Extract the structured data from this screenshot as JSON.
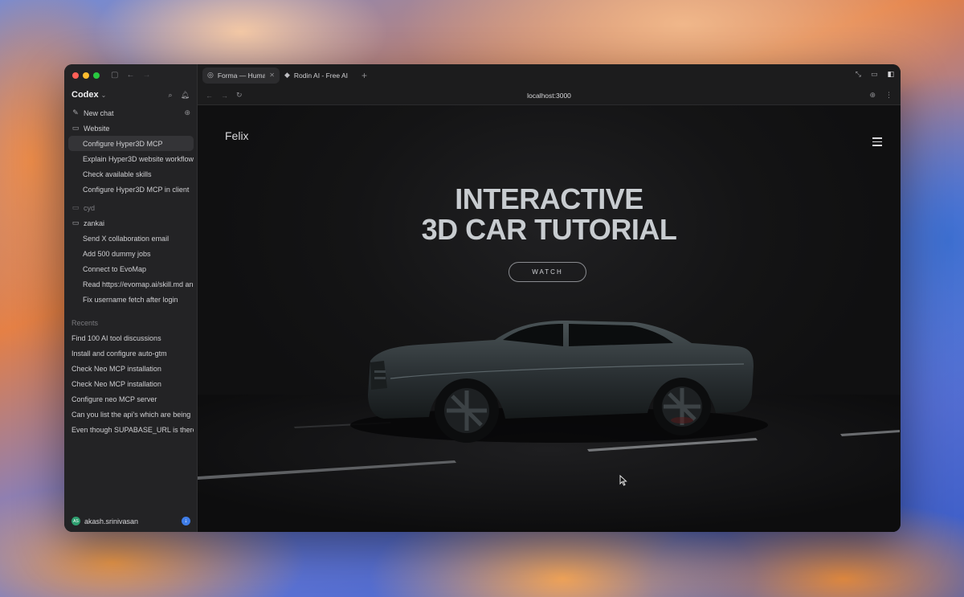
{
  "sidebar": {
    "brand": "Codex",
    "items": [
      {
        "label": "New chat",
        "icon": "edit-icon"
      },
      {
        "label": "Website",
        "icon": "folder-icon"
      },
      {
        "label": "Configure Hyper3D MCP"
      },
      {
        "label": "Explain Hyper3D website workflow"
      },
      {
        "label": "Check available skills"
      },
      {
        "label": "Configure Hyper3D MCP in client"
      },
      {
        "label": "cyd",
        "icon": "folder-icon"
      },
      {
        "label": "zankai",
        "icon": "folder-icon"
      },
      {
        "label": "Send X collaboration email"
      },
      {
        "label": "Add 500 dummy jobs"
      },
      {
        "label": "Connect to EvoMap"
      },
      {
        "label": "Read https://evomap.ai/skill.md and"
      },
      {
        "label": "Fix username fetch after login"
      }
    ],
    "recents_label": "Recents",
    "recents": [
      "Find 100 AI tool discussions",
      "Install and configure auto-gtm",
      "Check Neo MCP installation",
      "Check Neo MCP installation",
      "Configure neo MCP server",
      "Can you list the api's which are being",
      "Even though SUPABASE_URL is there"
    ],
    "user": {
      "name": "akash.srinivasan",
      "initials": "AS"
    }
  },
  "browser": {
    "tabs": [
      {
        "title": "Forma — Human",
        "active": true
      },
      {
        "title": "Rodin AI - Free AI",
        "active": false
      }
    ],
    "url": "localhost:3000"
  },
  "site": {
    "logo": "Felix",
    "hero_line1": "INTERACTIVE",
    "hero_line2": "3D CAR TUTORIAL",
    "cta": "WATCH"
  },
  "colors": {
    "window_bg": "#1b1b1c",
    "sidebar_bg": "#232325",
    "accent_blue": "#3f7de8",
    "avatar_green": "#2e9e6f"
  }
}
